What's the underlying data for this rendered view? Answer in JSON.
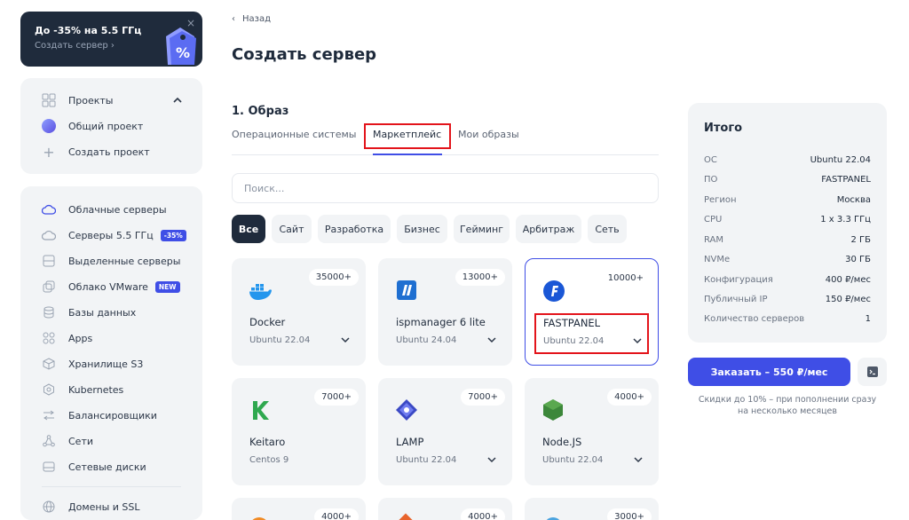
{
  "promo": {
    "title": "До -35% на 5.5 ГГц",
    "subtitle": "Создать сервер ›",
    "close": "×"
  },
  "projects": {
    "header": "Проекты",
    "items": [
      "Общий проект",
      "Создать проект"
    ]
  },
  "nav": {
    "items": [
      {
        "label": "Облачные серверы",
        "icon": "cloud-icon"
      },
      {
        "label": "Серверы 5.5 ГГц",
        "icon": "cloud-bolt-icon",
        "badge": "-35%"
      },
      {
        "label": "Выделенные серверы",
        "icon": "server-icon"
      },
      {
        "label": "Облако VMware",
        "icon": "vmware-icon",
        "badge": "NEW"
      },
      {
        "label": "Базы данных",
        "icon": "database-icon"
      },
      {
        "label": "Apps",
        "icon": "apps-icon"
      },
      {
        "label": "Хранилище S3",
        "icon": "storage-icon"
      },
      {
        "label": "Kubernetes",
        "icon": "kubernetes-icon"
      },
      {
        "label": "Балансировщики",
        "icon": "balancer-icon"
      },
      {
        "label": "Сети",
        "icon": "network-icon"
      },
      {
        "label": "Сетевые диски",
        "icon": "disk-icon"
      },
      {
        "label": "Домены и SSL",
        "icon": "globe-icon"
      }
    ]
  },
  "header": {
    "back": "Назад",
    "title": "Создать сервер"
  },
  "image_section": {
    "title": "1. Образ",
    "tabs": [
      "Операционные системы",
      "Маркетплейс",
      "Мои образы"
    ],
    "search_placeholder": "Поиск...",
    "filters": [
      "Все",
      "Сайт",
      "Разработка",
      "Бизнес",
      "Гейминг",
      "Арбитраж",
      "Сеть"
    ]
  },
  "apps": [
    {
      "name": "Docker",
      "os": "Ubuntu 22.04",
      "count": "35000+",
      "icon": "docker-icon",
      "color": "#2496ed"
    },
    {
      "name": "ispmanager 6 lite",
      "os": "Ubuntu 24.04",
      "count": "13000+",
      "icon": "ispmanager-icon",
      "color": "#1f6fd1"
    },
    {
      "name": "FASTPANEL",
      "os": "Ubuntu 22.04",
      "count": "10000+",
      "icon": "fastpanel-icon",
      "color": "#1a57d6"
    },
    {
      "name": "Keitaro",
      "os": "Centos 9",
      "count": "7000+",
      "icon": "keitaro-icon",
      "color": "#2fa84f"
    },
    {
      "name": "LAMP",
      "os": "Ubuntu 22.04",
      "count": "7000+",
      "icon": "lamp-icon",
      "color": "#3b49c4"
    },
    {
      "name": "Node.JS",
      "os": "Ubuntu 22.04",
      "count": "4000+",
      "icon": "nodejs-icon",
      "color": "#3c873a"
    },
    {
      "name": "",
      "os": "",
      "count": "4000+",
      "icon": "app-icon",
      "color": "#f08a24"
    },
    {
      "name": "",
      "os": "",
      "count": "4000+",
      "icon": "app-icon",
      "color": "#e8642c"
    },
    {
      "name": "",
      "os": "",
      "count": "3000+",
      "icon": "app-icon",
      "color": "#4aa3df"
    }
  ],
  "summary": {
    "title": "Итого",
    "rows": [
      {
        "k": "ОС",
        "v": "Ubuntu 22.04"
      },
      {
        "k": "ПО",
        "v": "FASTPANEL"
      },
      {
        "k": "Регион",
        "v": "Москва"
      },
      {
        "k": "CPU",
        "v": "1 x 3.3 ГГц"
      },
      {
        "k": "RAM",
        "v": "2 ГБ"
      },
      {
        "k": "NVMe",
        "v": "30 ГБ"
      },
      {
        "k": "Конфигурация",
        "v": "400 ₽/мес"
      },
      {
        "k": "Публичный IP",
        "v": "150 ₽/мес"
      },
      {
        "k": "Количество серверов",
        "v": "1"
      }
    ],
    "order": "Заказать – 550 ₽/мес",
    "discount": "Скидки до 10% – при пополнении сразу на несколько месяцев"
  }
}
